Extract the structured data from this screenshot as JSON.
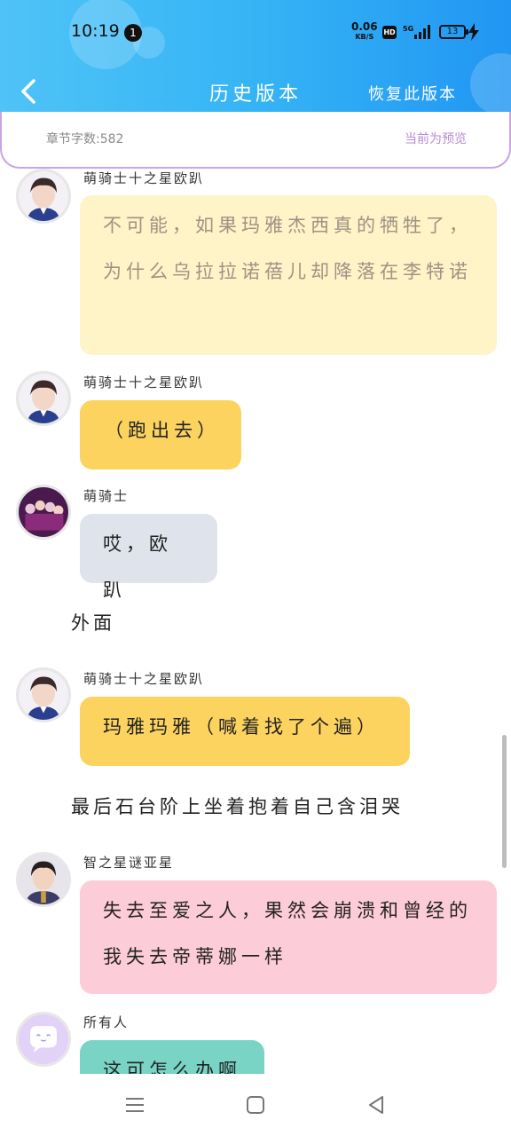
{
  "statusbar": {
    "time": "10:19",
    "notification_count": "1",
    "net_speed": "0.06",
    "net_unit": "KB/S",
    "hd_label": "HD",
    "signal_label": "5G",
    "battery_level": "13"
  },
  "header": {
    "title": "历史版本",
    "restore_label": "恢复此版本"
  },
  "info": {
    "word_count": "章节字数:582",
    "preview_label": "当前为预览"
  },
  "messages": [
    {
      "sender": "萌骑士十之星欧趴",
      "text": "不可能，如果玛雅杰西真的牺牲了，为什么乌拉拉诺蓓儿却降落在李特诺"
    },
    {
      "sender": "萌骑士十之星欧趴",
      "text": "（跑出去）"
    },
    {
      "sender": "萌骑士",
      "text": "哎，欧趴"
    },
    {
      "narration": "外面"
    },
    {
      "sender": "萌骑士十之星欧趴",
      "text": "玛雅玛雅（喊着找了个遍）"
    },
    {
      "narration": "最后石台阶上坐着抱着自己含泪哭"
    },
    {
      "sender": "智之星谜亚星",
      "text": "失去至爱之人，果然会崩溃和曾经的我失去帝蒂娜一样"
    },
    {
      "sender": "所有人",
      "text": "这可怎么办啊"
    }
  ],
  "colors": {
    "header_start": "#4fc3f7",
    "header_end": "#2196f3",
    "bubble_cream": "#fff3c8",
    "bubble_yellow": "#fdd35f",
    "bubble_gray": "#dfe4ec",
    "bubble_pink": "#fdccd9",
    "bubble_teal": "#79d4c6",
    "infobar_border": "#c9a4e6"
  },
  "icons": {
    "back": "chevron-left-icon",
    "menu": "menu-icon",
    "home": "square-home-icon",
    "nav_back": "triangle-back-icon"
  }
}
